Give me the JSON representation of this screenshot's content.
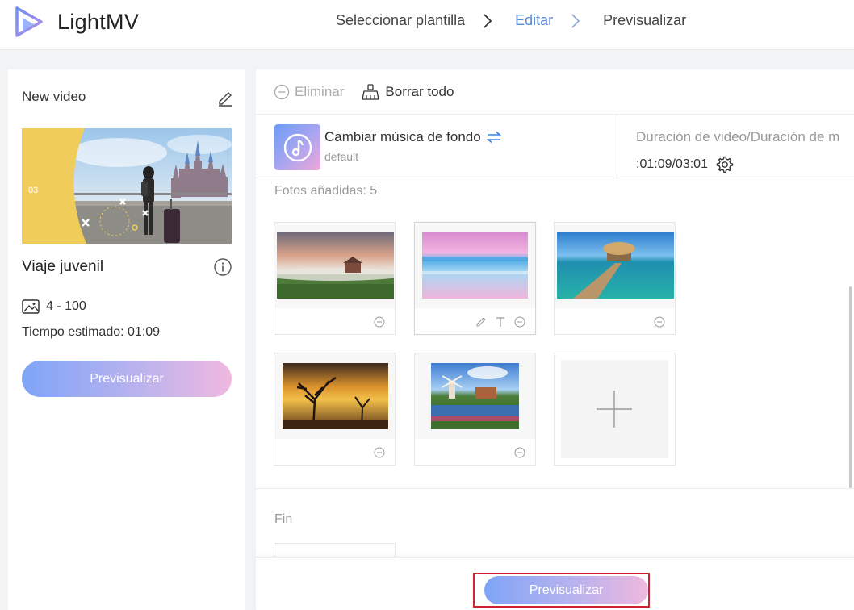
{
  "app": {
    "brand": "LightMV"
  },
  "steps": [
    {
      "label": "Seleccionar plantilla"
    },
    {
      "label": "Editar"
    },
    {
      "label": "Previsualizar"
    }
  ],
  "left_panel": {
    "video_name": "New video",
    "thumbnail_badge": "03",
    "template_name": "Viaje juvenil",
    "photo_range": "4 - 100",
    "estimated_time": "Tiempo estimado: 01:09",
    "preview_label": "Previsualizar"
  },
  "toolbar": {
    "delete_label": "Eliminar",
    "clear_all_label": "Borrar todo"
  },
  "music": {
    "title": "Cambiar música de fondo",
    "subtitle": "default"
  },
  "duration": {
    "label": "Duración de video/Duración de m",
    "value": ":01:09/03:01"
  },
  "photos": {
    "label": "Fotos añadidas: 5",
    "items": [
      {
        "subject": "misty field with red barn"
      },
      {
        "subject": "pink and blue sea"
      },
      {
        "subject": "wooden pier to hut"
      },
      {
        "subject": "sunset with bare trees"
      },
      {
        "subject": "windmill by pond with flowers"
      }
    ]
  },
  "end_section": {
    "label": "Fin"
  },
  "footer": {
    "preview_label": "Previsualizar"
  },
  "colors": {
    "accent_blue": "#5b8ad8",
    "gradient_start": "#7fa4f7",
    "gradient_end": "#f0b8df",
    "highlight_red": "#d2222d"
  }
}
